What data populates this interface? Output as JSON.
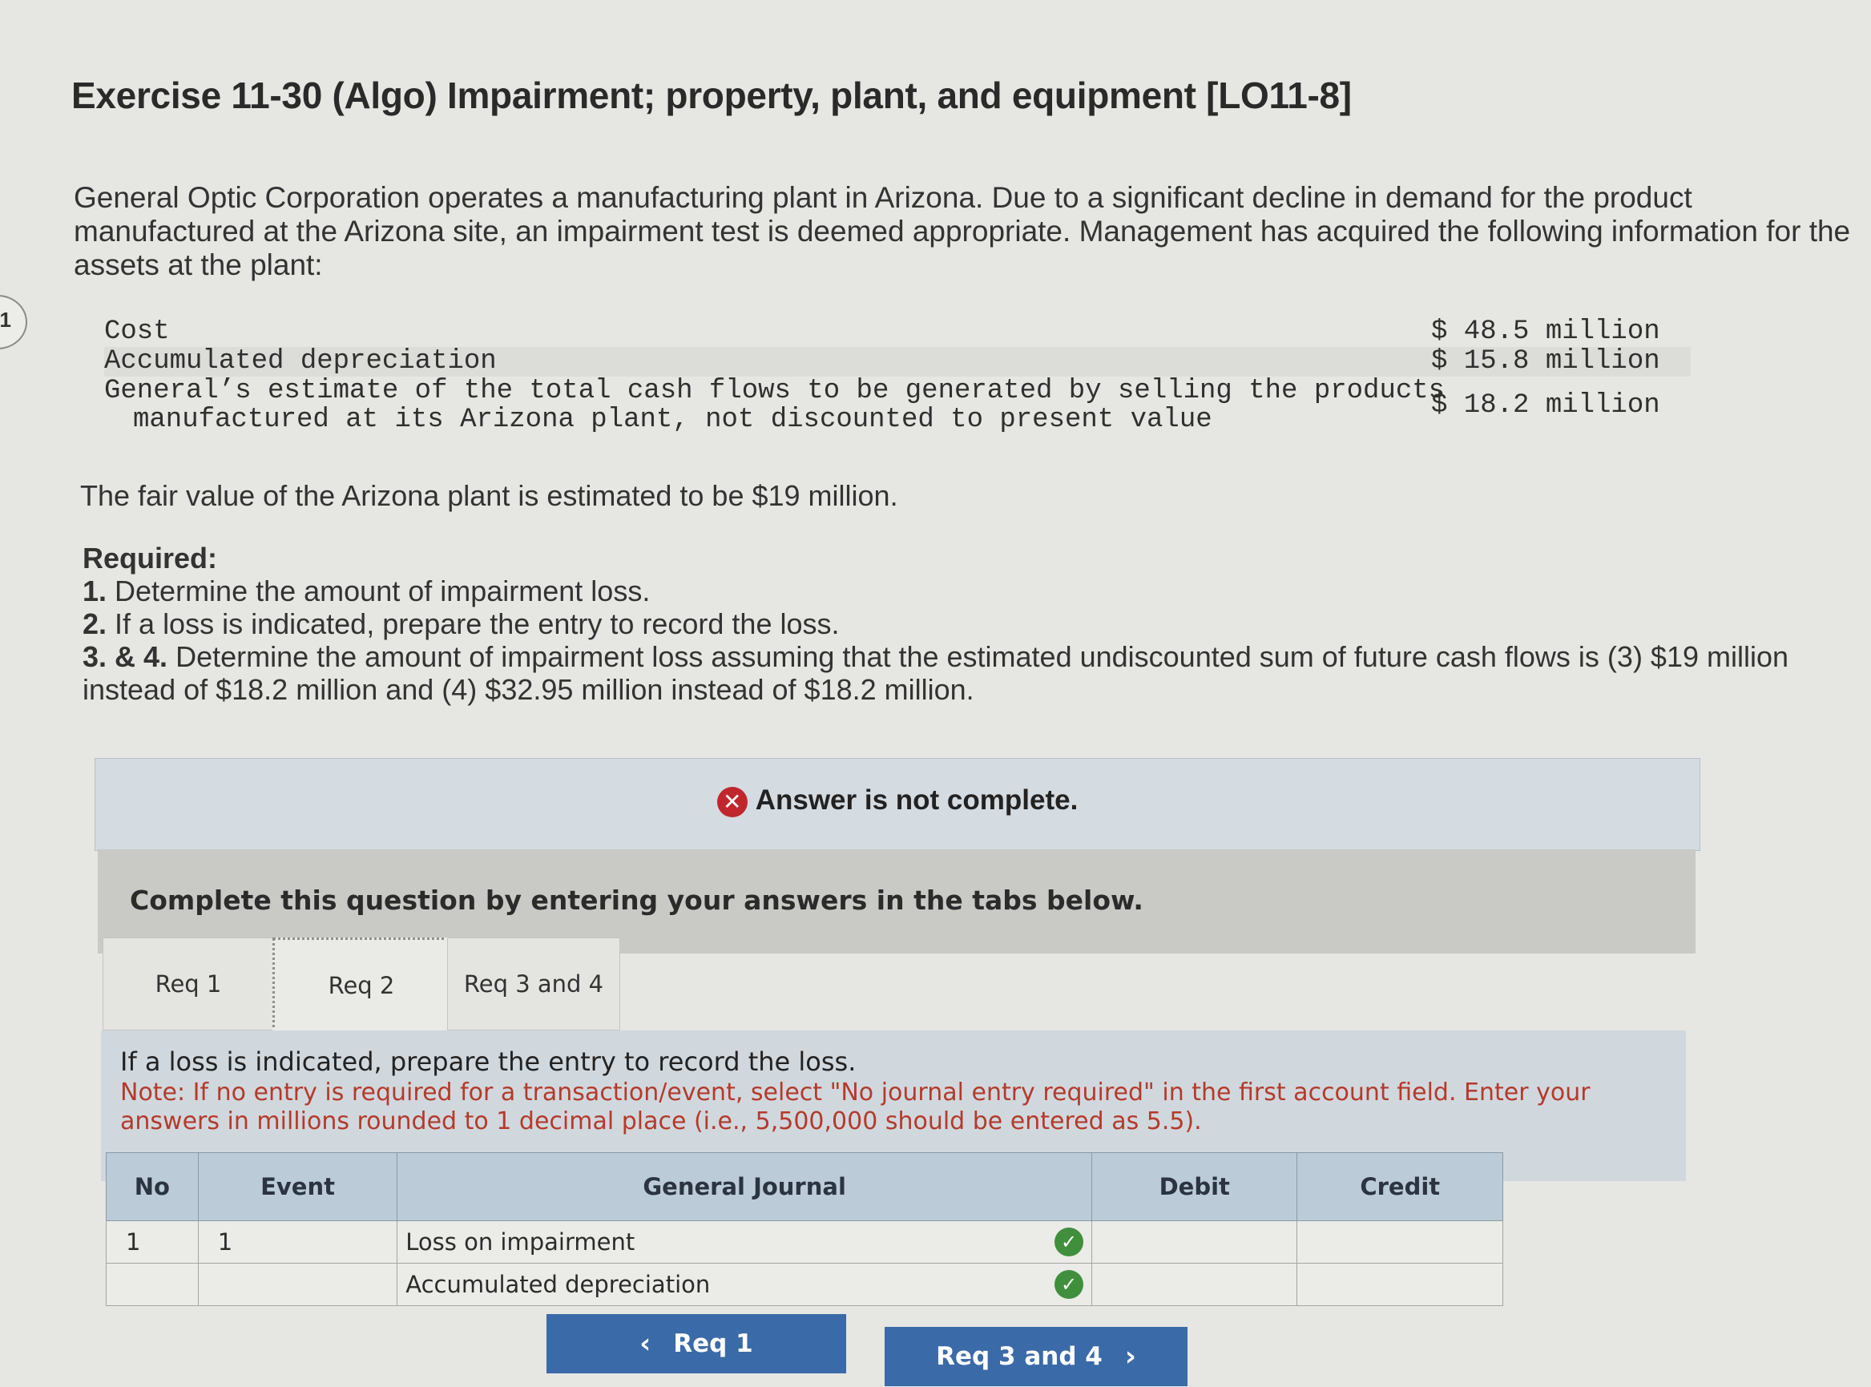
{
  "page_number_fragment": "1",
  "title": "Exercise 11-30 (Algo) Impairment; property, plant, and equipment [LO11-8]",
  "intro": "General Optic Corporation operates a manufacturing plant in Arizona. Due to a significant decline in demand for the product manufactured at the Arizona site, an impairment test is deemed appropriate. Management has acquired the following information for the assets at the plant:",
  "assets": {
    "cost_label": "Cost",
    "cost_value": "$ 48.5 million",
    "accum_label": "Accumulated depreciation",
    "accum_value": "$ 15.8 million",
    "cashflow_label_line1": "General’s estimate of the total cash flows to be generated by selling the products",
    "cashflow_label_line2": "manufactured at its Arizona plant, not discounted to present value",
    "cashflow_value": "$ 18.2 million"
  },
  "fair_value_text": "The fair value of the Arizona plant is estimated to be $19 million.",
  "required": {
    "heading": "Required:",
    "items": [
      {
        "num": "1.",
        "text": " Determine the amount of impairment loss."
      },
      {
        "num": "2.",
        "text": " If a loss is indicated, prepare the entry to record the loss."
      },
      {
        "num": "3. & 4.",
        "text": " Determine the amount of impairment loss assuming that the estimated undiscounted sum of future cash flows is (3) $19 million instead of $18.2 million and (4) $32.95 million instead of $18.2 million."
      }
    ]
  },
  "alert": {
    "icon": "x-circle-icon",
    "text": "Answer is not complete."
  },
  "instruction": "Complete this question by entering your answers in the tabs below.",
  "tabs": [
    {
      "label": "Req 1",
      "active": false
    },
    {
      "label": "Req 2",
      "active": true
    },
    {
      "label": "Req 3 and 4",
      "active": false
    }
  ],
  "tab_content": {
    "title": "If a loss is indicated, prepare the entry to record the loss.",
    "note": "Note: If no entry is required for a transaction/event, select \"No journal entry required\" in the first account field. Enter your answers in millions rounded to 1 decimal place (i.e., 5,500,000 should be entered as 5.5)."
  },
  "journal": {
    "headers": {
      "no": "No",
      "event": "Event",
      "general_journal": "General Journal",
      "debit": "Debit",
      "credit": "Credit"
    },
    "rows": [
      {
        "no": "1",
        "event": "1",
        "account": "Loss on impairment",
        "status": "check-icon",
        "debit": "",
        "credit": ""
      },
      {
        "no": "",
        "event": "",
        "account": "Accumulated depreciation",
        "status": "check-icon",
        "debit": "",
        "credit": ""
      }
    ]
  },
  "nav": {
    "prev_label": "Req 1",
    "next_label": "Req 3 and 4"
  },
  "colors": {
    "alert_icon": "#c0272d",
    "check_icon": "#3f8f3c",
    "nav_button": "#3b6aa8",
    "note_text": "#b53a2a",
    "table_header": "#bccbd8"
  }
}
